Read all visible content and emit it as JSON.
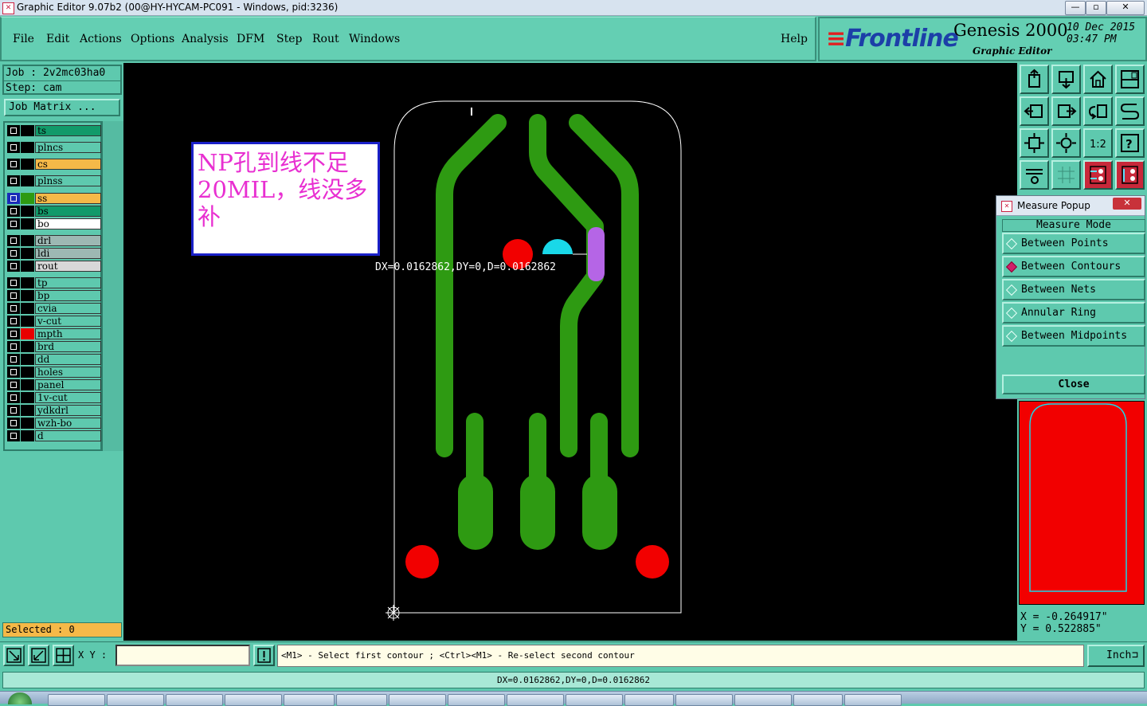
{
  "window": {
    "title": "Graphic Editor 9.07b2 (00@HY-HYCAM-PC091 - Windows, pid:3236)",
    "icon": "app-icon",
    "minimize": "—",
    "maximize": "▫",
    "close": "✕"
  },
  "menu": {
    "items": [
      "File",
      "Edit",
      "Actions",
      "Options",
      "Analysis",
      "DFM",
      "Step",
      "Rout",
      "Windows"
    ],
    "help": "Help"
  },
  "branding": {
    "logo": "Frontline",
    "product": "Genesis 2000",
    "subtitle": "Graphic Editor",
    "date": "10 Dec 2015",
    "time": "03:47 PM"
  },
  "job": {
    "job_line": "Job : 2v2mc03ha0",
    "step_line": "Step: cam",
    "matrix_button": "Job Matrix ..."
  },
  "layers": [
    {
      "name": "ts",
      "color": "#129a6a",
      "swatch": "#000000"
    },
    {
      "name": "plncs",
      "color": "#5ec9ae",
      "swatch": "#000000"
    },
    {
      "name": "cs",
      "color": "#f5b948",
      "swatch": "#000000"
    },
    {
      "name": "plnss",
      "color": "#5ec9ae",
      "swatch": "#000000"
    },
    {
      "name": "ss",
      "color": "#f5b948",
      "swatch": "#2e9a12",
      "active": true
    },
    {
      "name": "bs",
      "color": "#129a6a",
      "swatch": "#000000"
    },
    {
      "name": "bo",
      "color": "#ffffff",
      "swatch": "#000000"
    },
    {
      "name": "drl",
      "color": "#9db8b3",
      "swatch": "#000000"
    },
    {
      "name": "ldi",
      "color": "#9db8b3",
      "swatch": "#000000"
    },
    {
      "name": "rout",
      "color": "#d8d8d8",
      "swatch": "#000000"
    },
    {
      "name": "tp",
      "color": "#5ec9ae",
      "swatch": "#000000"
    },
    {
      "name": "bp",
      "color": "#5ec9ae",
      "swatch": "#000000"
    },
    {
      "name": "cvia",
      "color": "#5ec9ae",
      "swatch": "#000000"
    },
    {
      "name": "v-cut",
      "color": "#5ec9ae",
      "swatch": "#000000"
    },
    {
      "name": "mpth",
      "color": "#5ec9ae",
      "swatch": "#e80000"
    },
    {
      "name": "brd",
      "color": "#5ec9ae",
      "swatch": "#000000"
    },
    {
      "name": "dd",
      "color": "#5ec9ae",
      "swatch": "#000000"
    },
    {
      "name": "holes",
      "color": "#5ec9ae",
      "swatch": "#000000"
    },
    {
      "name": "panel",
      "color": "#5ec9ae",
      "swatch": "#000000"
    },
    {
      "name": "1v-cut",
      "color": "#5ec9ae",
      "swatch": "#000000"
    },
    {
      "name": "ydkdrl",
      "color": "#5ec9ae",
      "swatch": "#000000"
    },
    {
      "name": "wzh-bo",
      "color": "#5ec9ae",
      "swatch": "#000000"
    },
    {
      "name": "d",
      "color": "#5ec9ae",
      "swatch": "#000000"
    }
  ],
  "selected": "Selected : 0",
  "annotation": {
    "text": "NP孔到线不足20MIL，线没多补",
    "color": "#e82fd1"
  },
  "canvas": {
    "measure_text": "DX=0.0162862,DY=0,D=0.0162862",
    "background": "#000000",
    "trace_color": "#2e9a12",
    "pad_color": "#f20000",
    "cyan_color": "#19d8e8",
    "purple_color": "#b565e6"
  },
  "measure_popup": {
    "title": "Measure Popup",
    "close_x": "✕",
    "heading": "Measure Mode",
    "options": [
      {
        "label": "Between Points",
        "selected": false
      },
      {
        "label": "Between Contours",
        "selected": true
      },
      {
        "label": "Between Nets",
        "selected": false
      },
      {
        "label": "Annular Ring",
        "selected": false
      },
      {
        "label": "Between Midpoints",
        "selected": false
      }
    ],
    "close_button": "Close"
  },
  "coords": {
    "x": "X = -0.264917\"",
    "y": "Y = 0.522885\""
  },
  "command": {
    "xy_label": "X Y :",
    "xy_value": "",
    "prompt": "<M1> - Select first contour ; <Ctrl><M1> - Re-select second contour",
    "unit": "Inch"
  },
  "status": "DX=0.0162862,DY=0,D=0.0162862",
  "toolbar_icons": [
    "home-up-icon",
    "home-down-icon",
    "house-icon",
    "panel-view-icon",
    "arrow-left-icon",
    "arrow-right-icon",
    "undo-icon",
    "redo-icon",
    "fit-icon",
    "zoom-center-icon",
    "scale-1-2-icon",
    "help-icon",
    "tool-settings-icon",
    "grid-icon",
    "snap-red-icon",
    "snap-toggle-icon"
  ]
}
